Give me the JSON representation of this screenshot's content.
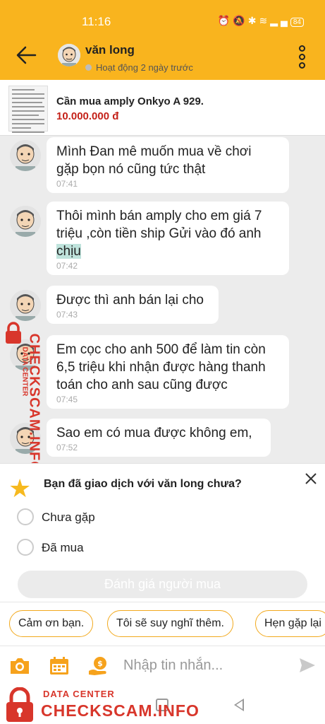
{
  "status_bar": {
    "time": "11:16",
    "icons": [
      "alarm-icon",
      "mute-icon",
      "bluetooth-icon",
      "wifi-icon",
      "signal-icon",
      "signal-icon"
    ],
    "battery": "84"
  },
  "header": {
    "name": "văn long",
    "status": "Hoạt động 2 ngày trước",
    "accent": "#f9b41e"
  },
  "product": {
    "title": "Cần mua amply Onkyo A 929.",
    "price": "10.000.000 đ",
    "price_color": "#c4221a"
  },
  "messages": [
    {
      "text": "Mình Đan mê muốn mua về chơi\ngặp bọn nó cũng tức thật",
      "time": "07:41"
    },
    {
      "text_before": "Thôi mình bán amply cho em giá 7\ntriệu ,còn tiền ship Gửi vào đó anh\n",
      "text_highlight": "chịu",
      "time": "07:42"
    },
    {
      "text": "Được thì anh bán lại cho",
      "time": "07:43"
    },
    {
      "text": "Em cọc cho anh 500 để làm tin còn\n6,5 triệu khi nhận được hàng thanh\ntoán cho anh sau cũng được",
      "time": "07:45"
    },
    {
      "text": "Sao em có mua được không em,",
      "time": "07:52"
    }
  ],
  "watermark": {
    "label": "DATA CENTER",
    "brand": "CHECKSCAM.INFO",
    "color": "#d8362b"
  },
  "review_panel": {
    "question": "Bạn đã giao dịch với văn long chưa?",
    "options": [
      "Chưa gặp",
      "Đã mua"
    ],
    "submit_label": "Đánh giá người mua"
  },
  "quick_replies": [
    "Cảm ơn bạn.",
    "Tôi sẽ suy nghĩ thêm.",
    "Hẹn gặp lại"
  ],
  "composer": {
    "placeholder": "Nhập tin nhắn..."
  }
}
